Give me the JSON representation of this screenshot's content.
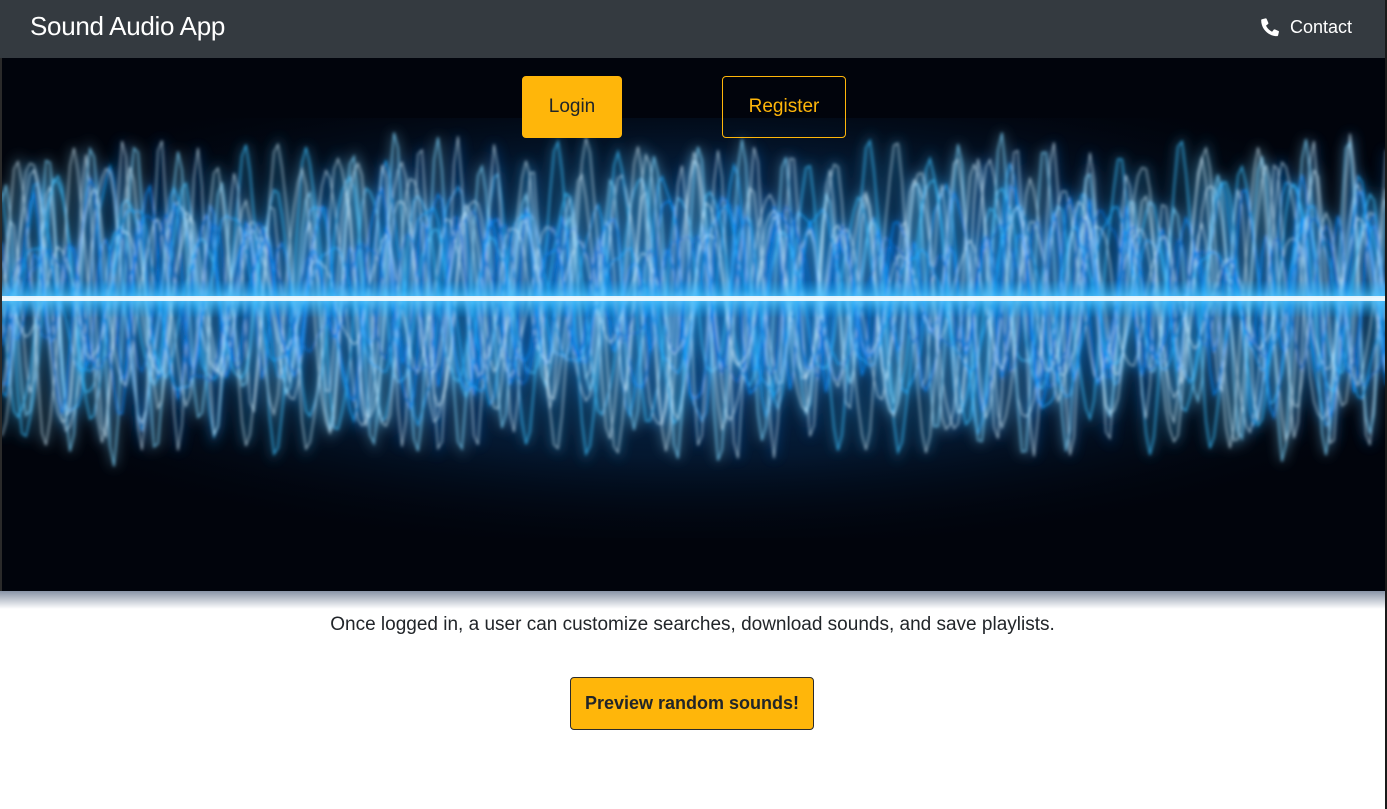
{
  "navbar": {
    "brand": "Sound Audio App",
    "contact_label": "Contact",
    "contact_icon": "phone-icon",
    "background_color": "#343a40"
  },
  "hero": {
    "login_label": "Login",
    "register_label": "Register",
    "accent_color": "#ffb60a",
    "wave_color": "#1aa3ff"
  },
  "main": {
    "tagline": "Once logged in, a user can customize searches, download sounds, and save playlists.",
    "preview_label": "Preview random sounds!"
  }
}
